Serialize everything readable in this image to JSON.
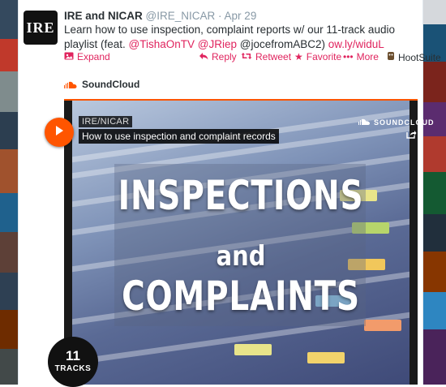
{
  "tweet": {
    "avatar_text": "IRE",
    "name": "IRE and NICAR",
    "handle": "@IRE_NICAR",
    "separator": "·",
    "date": "Apr 29",
    "text_before": "Learn how to use inspection, complaint reports w/ our 11-track audio playlist (feat. ",
    "mention_1": "@TishaOnTV",
    "mention_2": "@JRiep",
    "text_middle": " @jocefromABC2) ",
    "url": "ow.ly/widuL"
  },
  "actions": {
    "expand": "Expand",
    "reply": "Reply",
    "retweet": "Retweet",
    "favorite": "Favorite",
    "more": "More",
    "hootsuite": "HootSuite"
  },
  "embed": {
    "provider": "SoundCloud"
  },
  "player": {
    "user": "IRE/NICAR",
    "title": "How to use inspection and complaint records",
    "brand": "SOUNDCLOUD",
    "artwork_line1": "INSPECTIONS",
    "artwork_line2": "and",
    "artwork_line3": "COMPLAINTS",
    "track_count": "11",
    "tracks_label": "TRACKS"
  },
  "colors": {
    "accent": "#e0245e",
    "soundcloud": "#ff5500"
  }
}
